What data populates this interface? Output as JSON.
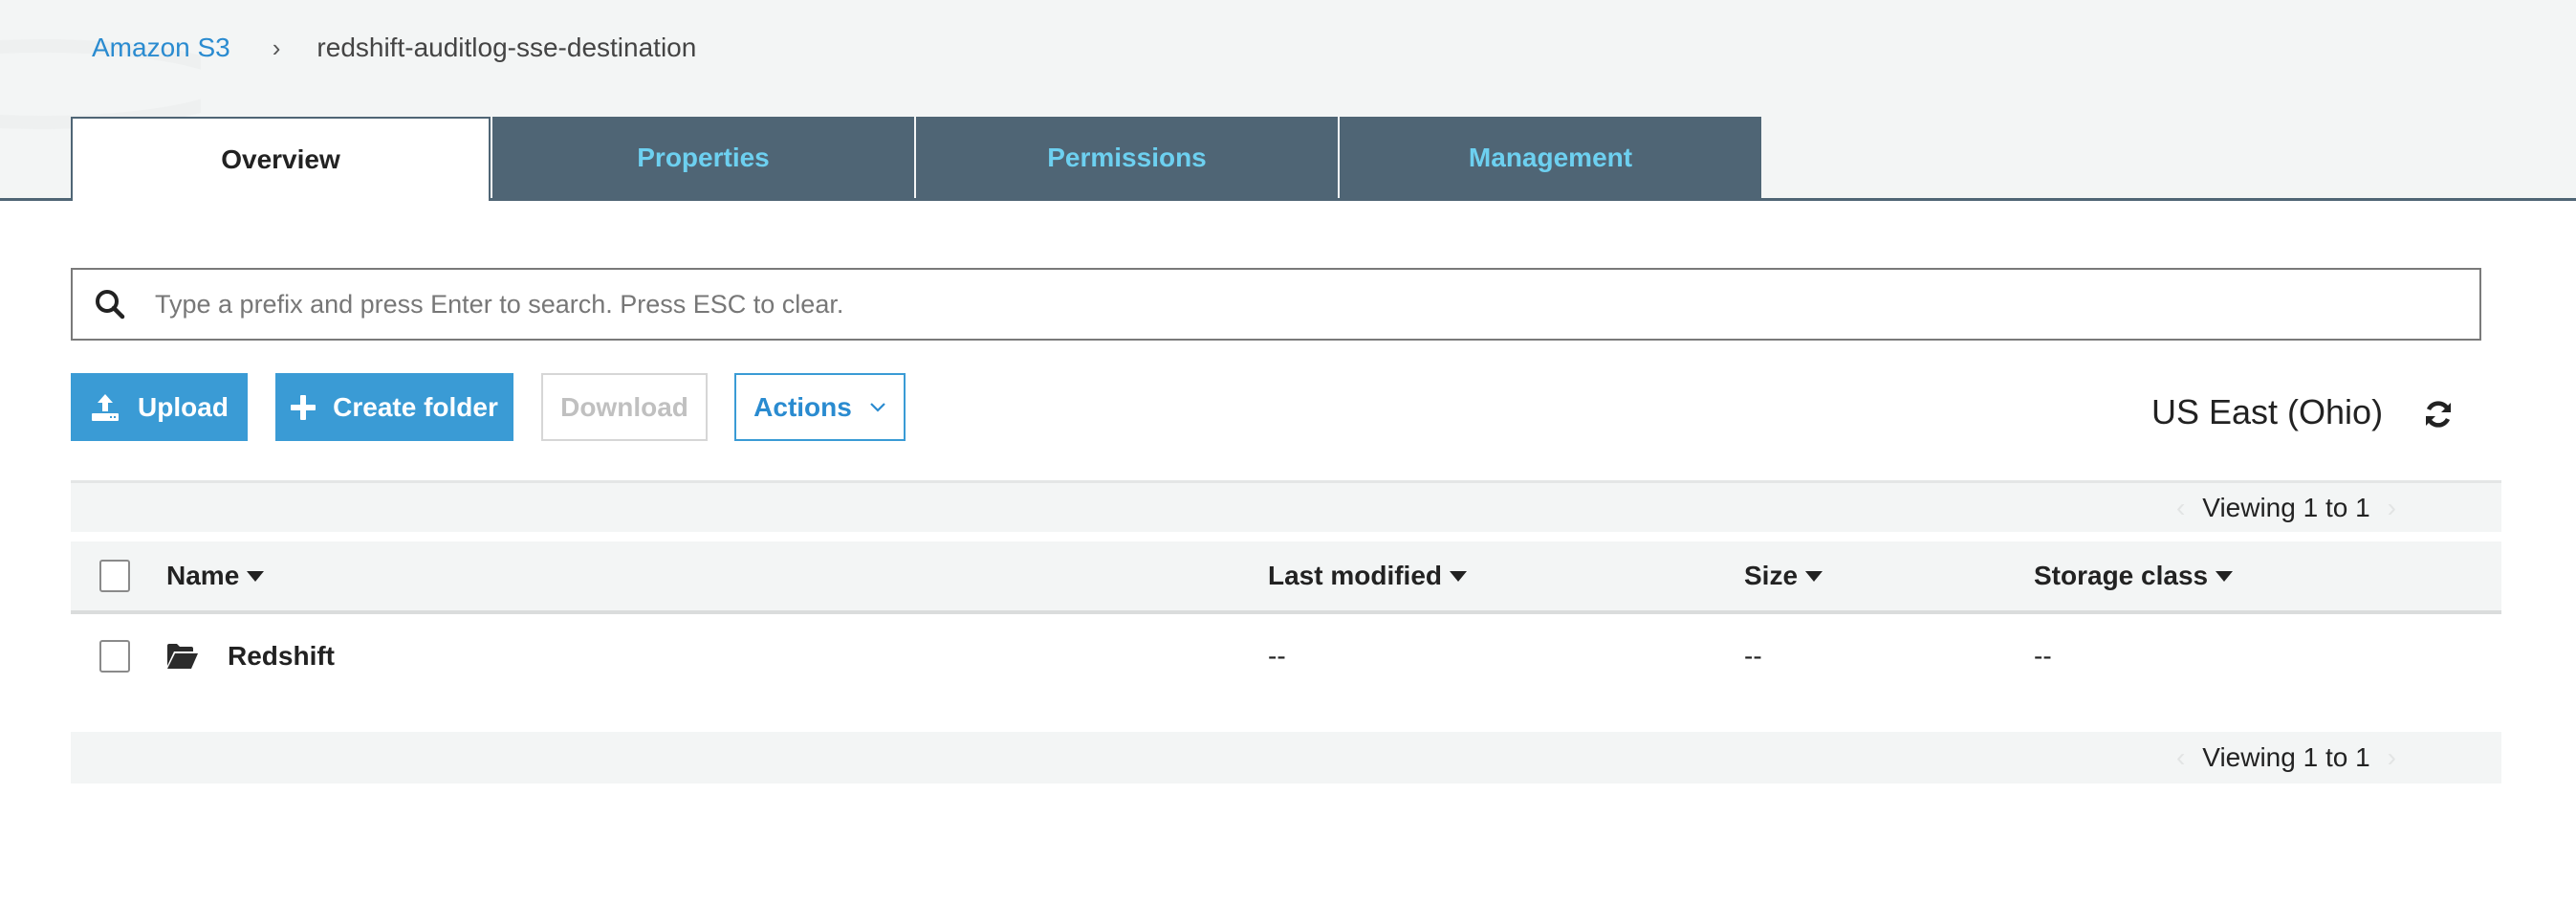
{
  "breadcrumb": {
    "root": "Amazon S3",
    "separator": "›",
    "current": "redshift-auditlog-sse-destination"
  },
  "tabs": [
    {
      "label": "Overview",
      "active": true
    },
    {
      "label": "Properties",
      "active": false
    },
    {
      "label": "Permissions",
      "active": false
    },
    {
      "label": "Management",
      "active": false
    }
  ],
  "search": {
    "icon": "search-icon",
    "value": "",
    "placeholder": "Type a prefix and press Enter to search. Press ESC to clear."
  },
  "toolbar": {
    "upload_label": "Upload",
    "upload_icon": "upload-icon",
    "create_folder_label": "Create folder",
    "create_folder_icon": "plus-icon",
    "download_label": "Download",
    "download_disabled": true,
    "actions_label": "Actions",
    "actions_icon": "chevron-down-icon"
  },
  "region": {
    "label": "US East (Ohio)",
    "refresh_icon": "refresh-icon"
  },
  "pager": {
    "text": "Viewing 1 to 1",
    "prev": "‹",
    "next": "›"
  },
  "table": {
    "columns": [
      "Name",
      "Last modified",
      "Size",
      "Storage class"
    ],
    "rows": [
      {
        "icon": "folder-open-icon",
        "name": "Redshift",
        "last_modified": "--",
        "size": "--",
        "storage_class": "--"
      }
    ]
  },
  "colors": {
    "accent": "#3a9bd5",
    "link": "#2a8bd0",
    "tab_bg": "#4f6575",
    "tab_text": "#6dd0f0",
    "header_bg": "#f3f5f5"
  }
}
